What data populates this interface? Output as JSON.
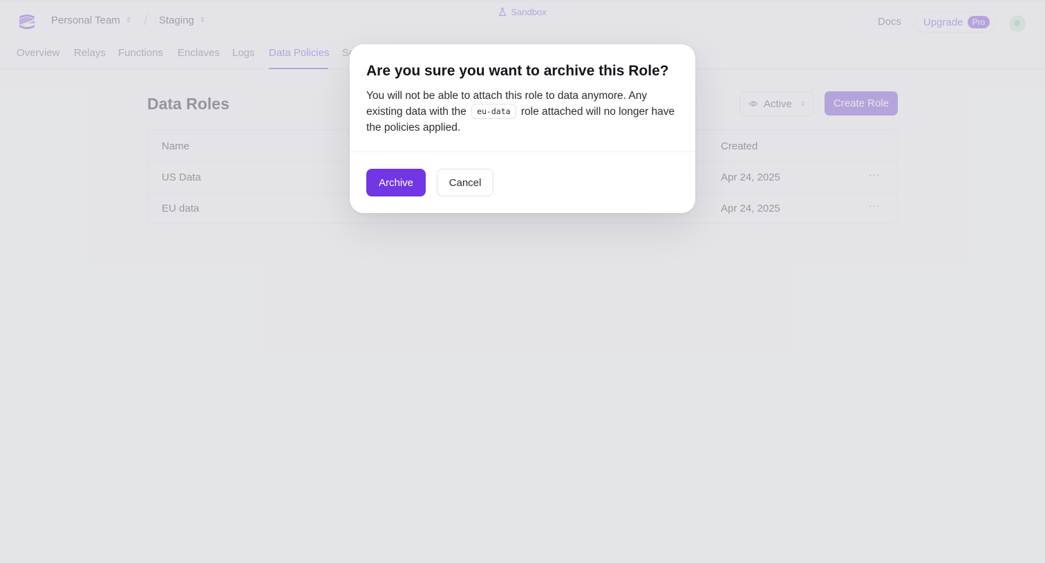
{
  "header": {
    "team": "Personal Team",
    "environment": "Staging",
    "sandbox_label": "Sandbox",
    "docs": "Docs",
    "upgrade": "Upgrade",
    "plan_badge": "Pro",
    "avatar_initial": "B"
  },
  "nav": {
    "tabs": [
      {
        "label": "Overview"
      },
      {
        "label": "Relays"
      },
      {
        "label": "Functions"
      },
      {
        "label": "Enclaves"
      },
      {
        "label": "Logs"
      },
      {
        "label": "Data Policies",
        "active": true
      },
      {
        "label": "Se"
      }
    ]
  },
  "main": {
    "title": "Data Roles",
    "filter": "Active",
    "create_button": "Create Role",
    "table": {
      "columns": [
        "Name",
        "Created"
      ],
      "rows": [
        {
          "name": "US Data",
          "created": "Apr 24, 2025",
          "actions": "···"
        },
        {
          "name": "EU data",
          "created": "Apr 24, 2025",
          "actions": "···"
        }
      ]
    }
  },
  "modal": {
    "title": "Are you sure you want to archive this Role?",
    "body_pre": "You will not be able to attach this role to data anymore. Any existing data with the",
    "role_code": "eu-data",
    "body_post": "role attached will no longer have the policies applied.",
    "archive_button": "Archive",
    "cancel_button": "Cancel"
  },
  "colors": {
    "accent": "#7c4ddb",
    "archive": "#7236e4"
  }
}
